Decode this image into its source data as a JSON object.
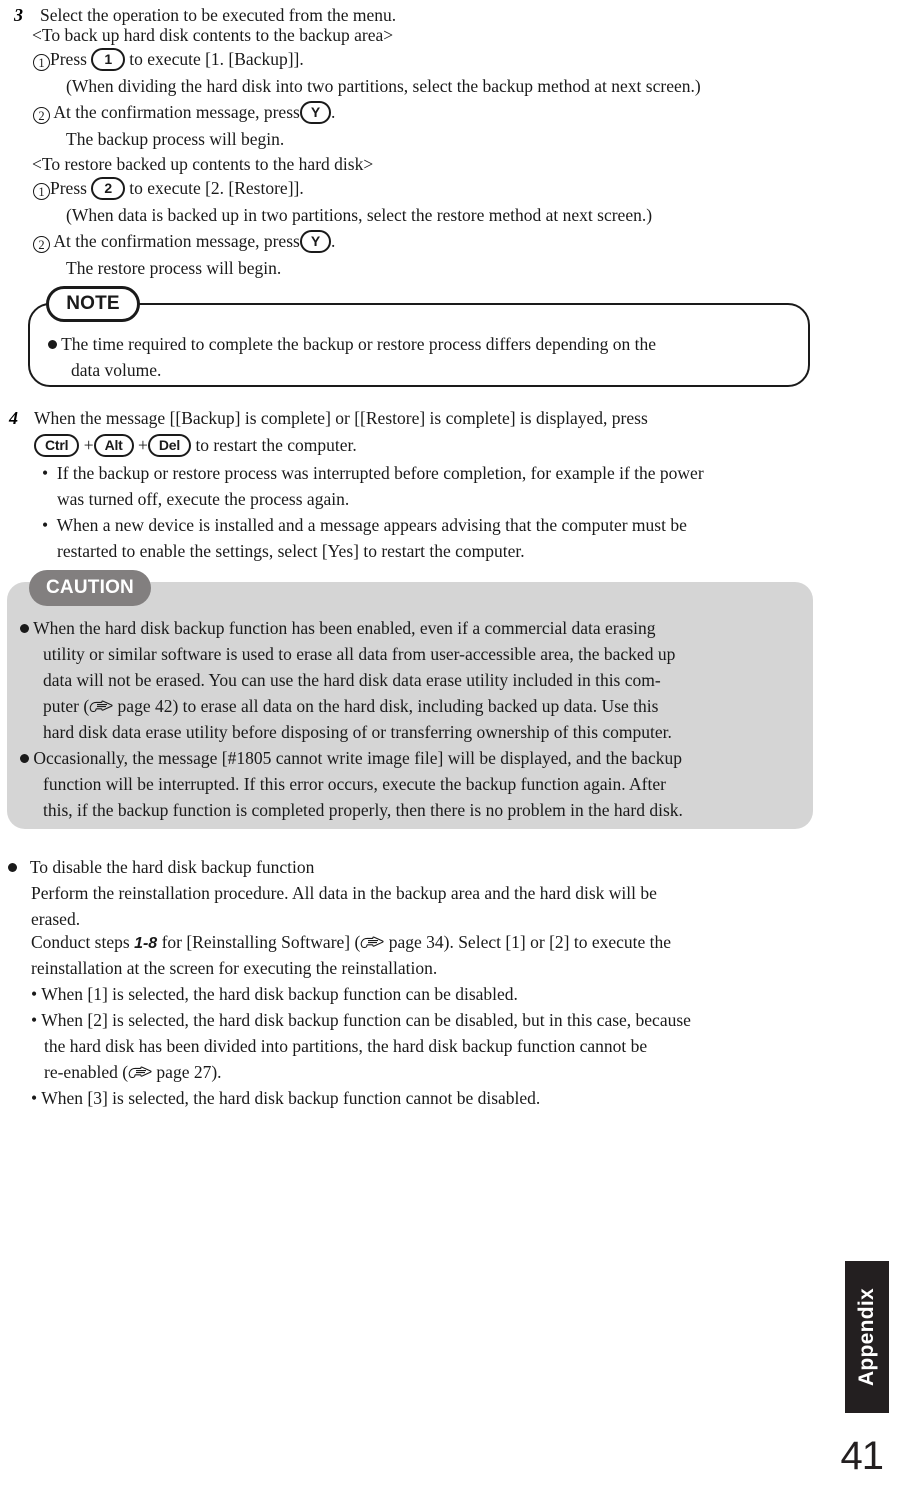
{
  "document": {
    "page_number": "41",
    "side_tab_label": "Appendix"
  },
  "step3": {
    "number": "3",
    "title": "Select the operation to be executed from the menu.",
    "backup_heading": "<To back up hard disk contents to the backup area>",
    "backup_item1_marker": "1",
    "backup_item1_pre": "Press",
    "backup_item1_key": "1",
    "backup_item1_post": "to execute [1. [Backup]].",
    "backup_item1_note": "(When dividing the hard disk into two partitions, select the backup method at next screen.)",
    "backup_item2_marker": "2",
    "backup_item2_pre": "At the confirmation message, press",
    "backup_item2_key": "Y",
    "backup_item2_post": ".",
    "backup_item2_note": "The backup process will begin.",
    "restore_heading": "<To restore backed up contents to the hard disk>",
    "restore_item1_marker": "1",
    "restore_item1_pre": "Press",
    "restore_item1_key": "2",
    "restore_item1_post": "to execute [2. [Restore]].",
    "restore_item1_note": "(When data is backed up in two partitions, select the restore method at next screen.)",
    "restore_item2_marker": "2",
    "restore_item2_pre": "At the confirmation message, press",
    "restore_item2_key": "Y",
    "restore_item2_post": ".",
    "restore_item2_note": "The restore process will begin."
  },
  "note_box": {
    "badge": "NOTE",
    "line1": "The time required to complete the backup or restore process differs depending on the",
    "line2": "data volume."
  },
  "step4": {
    "number": "4",
    "line1": "When the message [[Backup] is complete] or [[Restore] is complete] is displayed, press",
    "key1": "Ctrl",
    "plus1": "+",
    "key2": "Alt",
    "plus2": "+",
    "key3": "Del",
    "line2_tail": "to restart the computer.",
    "bullet1_line1": "If the backup or restore process was interrupted before completion, for example if the power",
    "bullet1_line2": "was turned off, execute the process again.",
    "bullet2_line1": "When a new device is installed and a message appears advising that the computer must be",
    "bullet2_line2": "restarted to enable the settings, select [Yes] to restart the computer."
  },
  "caution_box": {
    "badge": "CAUTION",
    "item1": {
      "line1": "When the hard disk backup function has been enabled, even if a commercial data erasing",
      "line2": "utility or similar software is used to erase all data from user-accessible area, the backed up",
      "line3": "data will not be erased.  You can use the hard disk data erase utility included in this com-",
      "line4_pre": "puter (",
      "line4_ref": "page 42",
      "line4_post": ") to erase all data on the hard disk, including backed up data. Use this",
      "line5": "hard disk data erase utility before disposing of or transferring ownership of this computer."
    },
    "item2": {
      "line1": "Occasionally, the message [#1805 cannot write image file] will be displayed, and the backup",
      "line2": "function will be interrupted.  If this error occurs, execute the backup function again.  After",
      "line3": "this, if the backup function is completed properly, then there is no problem in the hard disk."
    }
  },
  "disable_section": {
    "heading": "To disable the hard disk backup function",
    "line1": "Perform the reinstallation procedure.  All data in the backup area and the hard disk will be",
    "line2": "erased.",
    "line3_pre": "Conduct steps",
    "line3_steps": "1-8",
    "line3_mid": "for [Reinstalling Software]  (",
    "line3_ref": "page 34",
    "line3_post": "). Select [1] or [2] to execute the",
    "line4": "reinstallation at the screen for executing the reinstallation.",
    "bullet1": "When [1] is selected, the hard disk backup function can be disabled.",
    "bullet2_line1": "When [2] is selected, the hard disk backup function can be disabled, but in this case, because",
    "bullet2_line2": "the hard disk has been divided into partitions, the hard disk backup function cannot be",
    "bullet2_line3_pre": "re-enabled  (",
    "bullet2_line3_ref": "page 27",
    "bullet2_line3_post": ").",
    "bullet3": "When [3] is selected, the hard disk backup function cannot be disabled."
  },
  "colors": {
    "text": "#1a1a1a",
    "caution_box_bg": "#d5d5d5",
    "caution_badge_bg": "#827f7f",
    "tab_bg": "#231f20"
  }
}
